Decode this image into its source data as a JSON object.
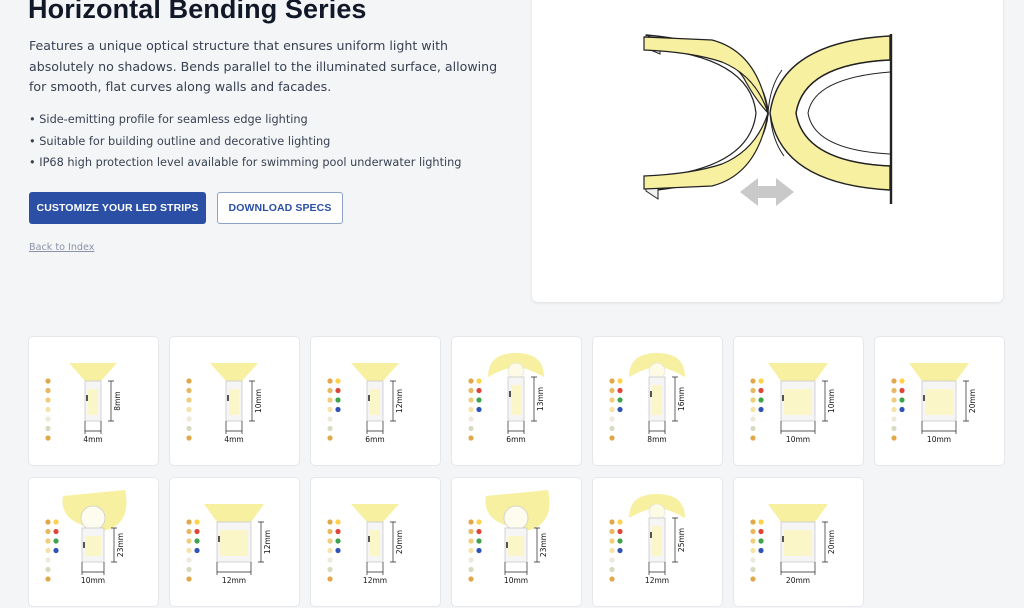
{
  "header": {
    "title": "Horizontal Bending Series"
  },
  "intro": {
    "description": "Features a unique optical structure that ensures uniform light with absolutely no shadows. Bends parallel to the illuminated surface, allowing for smooth, flat curves along walls and facades.",
    "features": [
      "• Side-emitting profile for seamless edge lighting",
      "• Suitable for building outline and decorative lighting",
      "• IP68 high protection level available for swimming pool underwater lighting"
    ]
  },
  "actions": {
    "customize_label": "CUSTOMIZE YOUR LED STRIPS",
    "download_label": "DOWNLOAD SPECS",
    "back_label": "Back to Index"
  },
  "products": [
    {
      "height": "8mm",
      "width": "4mm",
      "style": "narrow-beam"
    },
    {
      "height": "10mm",
      "width": "4mm",
      "style": "narrow-beam"
    },
    {
      "height": "12mm",
      "width": "6mm",
      "style": "narrow-beam"
    },
    {
      "height": "13mm",
      "width": "6mm",
      "style": "dome"
    },
    {
      "height": "16mm",
      "width": "8mm",
      "style": "dome"
    },
    {
      "height": "10mm",
      "width": "10mm",
      "style": "wide-beam"
    },
    {
      "height": "20mm",
      "width": "10mm",
      "style": "wide-beam"
    },
    {
      "height": "23mm",
      "width": "10mm",
      "style": "round-head"
    },
    {
      "height": "12mm",
      "width": "12mm",
      "style": "wide-beam"
    },
    {
      "height": "20mm",
      "width": "12mm",
      "style": "narrow-beam"
    },
    {
      "height": "23mm",
      "width": "10mm",
      "style": "round-head"
    },
    {
      "height": "25mm",
      "width": "12mm",
      "style": "dome"
    },
    {
      "height": "20mm",
      "width": "20mm",
      "style": "wide-beam"
    }
  ],
  "colors": {
    "accent": "#2a4fa5",
    "glow": "#f7f0a0",
    "dots": [
      "#e0a84a",
      "#e8b860",
      "#f0cd7a",
      "#f6e2a6",
      "#efe9dc",
      "#d9d9c0",
      "#ffd24d",
      "#e0453a",
      "#3fa34d",
      "#2f54b8",
      "#c8a060"
    ]
  }
}
